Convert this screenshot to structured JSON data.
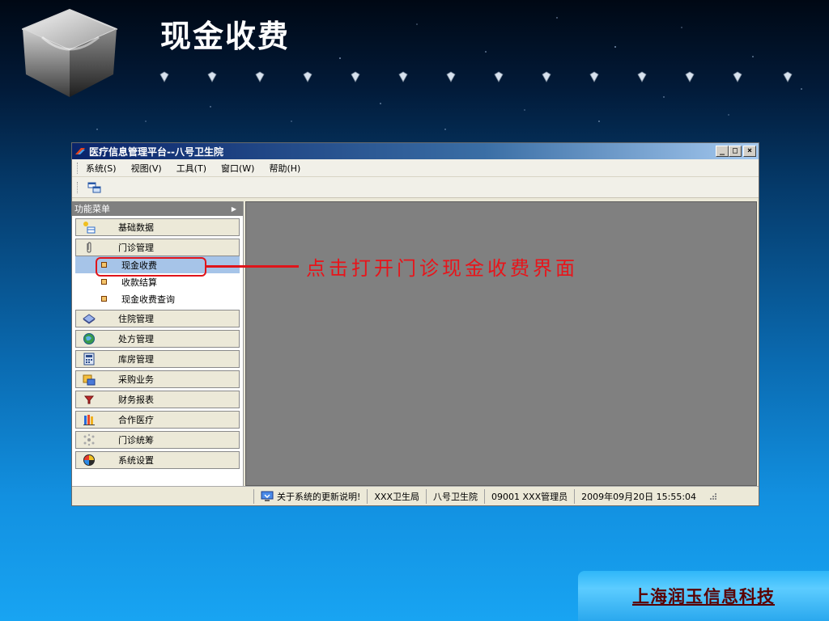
{
  "slide": {
    "title": "现金收费",
    "callout": "点击打开门诊现金收费界面",
    "brand": "上海润玉信息科技"
  },
  "window": {
    "title": "医疗信息管理平台--八号卫生院",
    "controls": {
      "minimize": "_",
      "maximize": "□",
      "close": "×"
    }
  },
  "menubar": {
    "items": [
      "系统(S)",
      "视图(V)",
      "工具(T)",
      "窗口(W)",
      "帮助(H)"
    ]
  },
  "sidebar": {
    "header": "功能菜单",
    "groups": [
      {
        "label": "基础数据",
        "icon": "data-table-icon"
      },
      {
        "label": "门诊管理",
        "icon": "paperclip-icon",
        "expanded": true,
        "items": [
          {
            "label": "现金收费",
            "selected": true
          },
          {
            "label": "收款结算",
            "selected": false
          },
          {
            "label": "现金收费查询",
            "selected": false
          }
        ]
      },
      {
        "label": "住院管理",
        "icon": "book-icon"
      },
      {
        "label": "处方管理",
        "icon": "globe-icon"
      },
      {
        "label": "库房管理",
        "icon": "calculator-icon"
      },
      {
        "label": "采购业务",
        "icon": "folder-icon"
      },
      {
        "label": "财务报表",
        "icon": "funnel-icon"
      },
      {
        "label": "合作医疗",
        "icon": "books-icon"
      },
      {
        "label": "门诊统筹",
        "icon": "molecule-icon"
      },
      {
        "label": "系统设置",
        "icon": "settings-icon"
      }
    ]
  },
  "statusbar": {
    "notice": "关于系统的更新说明!",
    "bureau": "XXX卫生局",
    "hospital": "八号卫生院",
    "user": "09001 XXX管理员",
    "datetime": "2009年09月20日 15:55:04"
  },
  "colors": {
    "accent_red": "#e0141a",
    "selection": "#a6c4e8",
    "mdi_gray": "#808080"
  }
}
